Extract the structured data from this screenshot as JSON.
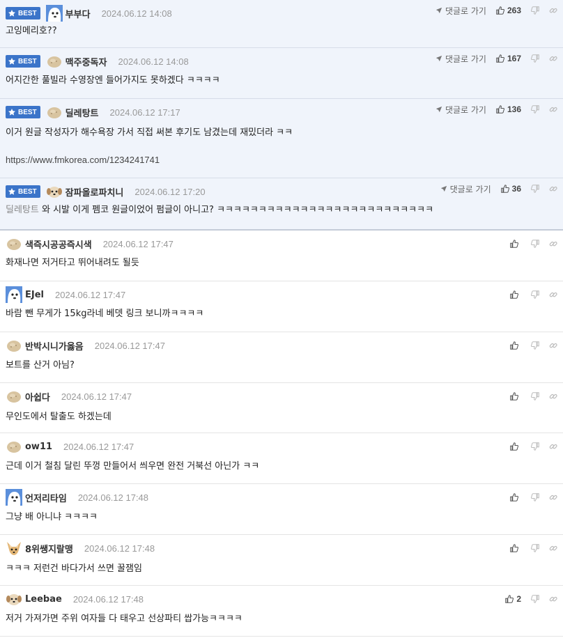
{
  "labels": {
    "best": "BEST",
    "reply": "댓글로 가기"
  },
  "comments": [
    {
      "best": true,
      "avatar": "blue-cartoon-avatar",
      "nick": "부부다",
      "date": "2024.06.12 14:08",
      "text": "고잉메리호??",
      "likes": "263"
    },
    {
      "best": true,
      "avatar": "potato-avatar",
      "nick": "맥주중독자",
      "date": "2024.06.12 14:08",
      "text": "어지간한 풀빌라 수영장엔 들어가지도 못하겠다 ㅋㅋㅋㅋ",
      "likes": "167"
    },
    {
      "best": true,
      "avatar": "potato-avatar",
      "nick": "딜레탕트",
      "date": "2024.06.12 17:17",
      "text": "이거 원글 작성자가 해수욕장 가서 직접 써본 후기도 남겼는데 재밌더라 ㅋㅋ",
      "url": "https://www.fmkorea.com/1234241741",
      "likes": "136"
    },
    {
      "best": true,
      "avatar": "dog-avatar",
      "nick": "잠파올로파치니",
      "date": "2024.06.12 17:20",
      "mention": "딜레탕트",
      "text": " 와 시발 이게 펨코 원글이었어 펌글이 아니고? ㅋㅋㅋㅋㅋㅋㅋㅋㅋㅋㅋㅋㅋㅋㅋㅋㅋㅋㅋㅋㅋㅋㅋㅋㅋㅋ",
      "likes": "36"
    },
    {
      "best": false,
      "avatar": "potato-avatar",
      "nick": "색즉시공공즉시색",
      "date": "2024.06.12 17:47",
      "text": "화재나면 저거타고 뛰어내려도 될듯",
      "likes": ""
    },
    {
      "best": false,
      "avatar": "blue-cartoon-avatar",
      "nick": "EJel",
      "date": "2024.06.12 17:47",
      "text": "바람 뺀 무게가 15kg라네 베뎃 링크 보니까ㅋㅋㅋㅋ",
      "likes": ""
    },
    {
      "best": false,
      "avatar": "potato-avatar",
      "nick": "반박시니가옳음",
      "date": "2024.06.12 17:47",
      "text": "보트를 산거 아님?",
      "likes": ""
    },
    {
      "best": false,
      "avatar": "potato-avatar",
      "nick": "아쉽다",
      "date": "2024.06.12 17:47",
      "text": "무인도에서 탈출도 하겠는데",
      "likes": ""
    },
    {
      "best": false,
      "avatar": "potato-avatar",
      "nick": "ow11",
      "date": "2024.06.12 17:47",
      "text": "근데 이거 철침 달린 뚜껑 만들어서 씌우면 완전 거북선 아닌가 ㅋㅋ",
      "likes": ""
    },
    {
      "best": false,
      "avatar": "blue-cartoon-avatar",
      "nick": "언저리타임",
      "date": "2024.06.12 17:48",
      "text": "그냥 배 아니냐 ㅋㅋㅋㅋ",
      "likes": ""
    },
    {
      "best": false,
      "avatar": "chihuahua-avatar",
      "nick": "8위쌩지랄맹",
      "date": "2024.06.12 17:48",
      "text": "ㅋㅋㅋ 저런건 바다가서 쓰면 꿀잼임",
      "likes": ""
    },
    {
      "best": false,
      "avatar": "dog-avatar",
      "nick": "Leebae",
      "date": "2024.06.12 17:48",
      "text": "저거 가져가면 주위 여자들 다 태우고 선상파티 쌉가능ㅋㅋㅋㅋ",
      "likes": "2"
    }
  ]
}
